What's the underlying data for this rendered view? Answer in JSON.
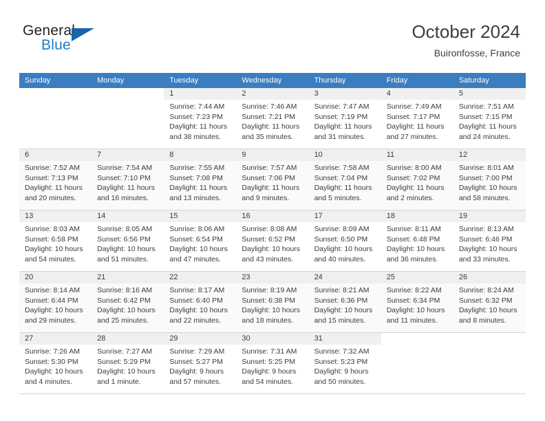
{
  "brand": {
    "name_line1": "General",
    "name_line2": "Blue",
    "logo_icon": "triangle-logo-icon",
    "color_dark": "#231f20",
    "color_blue": "#1c7cc4"
  },
  "header": {
    "title": "October 2024",
    "subtitle": "Buironfosse, France"
  },
  "theme": {
    "header_row_bg": "#3a7dc0",
    "header_row_text": "#ffffff",
    "day_number_bg": "#f0f0f0",
    "grid_line": "#d4d4d4",
    "text": "#3b3b3b"
  },
  "calendar": {
    "weekday_headers": [
      "Sunday",
      "Monday",
      "Tuesday",
      "Wednesday",
      "Thursday",
      "Friday",
      "Saturday"
    ],
    "labels": {
      "sunrise_prefix": "Sunrise:",
      "sunset_prefix": "Sunset:",
      "daylight_prefix": "Daylight:"
    },
    "weeks": [
      [
        {
          "day": "",
          "lines": []
        },
        {
          "day": "",
          "lines": []
        },
        {
          "day": "1",
          "lines": [
            "Sunrise: 7:44 AM",
            "Sunset: 7:23 PM",
            "Daylight: 11 hours",
            "and 38 minutes."
          ]
        },
        {
          "day": "2",
          "lines": [
            "Sunrise: 7:46 AM",
            "Sunset: 7:21 PM",
            "Daylight: 11 hours",
            "and 35 minutes."
          ]
        },
        {
          "day": "3",
          "lines": [
            "Sunrise: 7:47 AM",
            "Sunset: 7:19 PM",
            "Daylight: 11 hours",
            "and 31 minutes."
          ]
        },
        {
          "day": "4",
          "lines": [
            "Sunrise: 7:49 AM",
            "Sunset: 7:17 PM",
            "Daylight: 11 hours",
            "and 27 minutes."
          ]
        },
        {
          "day": "5",
          "lines": [
            "Sunrise: 7:51 AM",
            "Sunset: 7:15 PM",
            "Daylight: 11 hours",
            "and 24 minutes."
          ]
        }
      ],
      [
        {
          "day": "6",
          "lines": [
            "Sunrise: 7:52 AM",
            "Sunset: 7:13 PM",
            "Daylight: 11 hours",
            "and 20 minutes."
          ]
        },
        {
          "day": "7",
          "lines": [
            "Sunrise: 7:54 AM",
            "Sunset: 7:10 PM",
            "Daylight: 11 hours",
            "and 16 minutes."
          ]
        },
        {
          "day": "8",
          "lines": [
            "Sunrise: 7:55 AM",
            "Sunset: 7:08 PM",
            "Daylight: 11 hours",
            "and 13 minutes."
          ]
        },
        {
          "day": "9",
          "lines": [
            "Sunrise: 7:57 AM",
            "Sunset: 7:06 PM",
            "Daylight: 11 hours",
            "and 9 minutes."
          ]
        },
        {
          "day": "10",
          "lines": [
            "Sunrise: 7:58 AM",
            "Sunset: 7:04 PM",
            "Daylight: 11 hours",
            "and 5 minutes."
          ]
        },
        {
          "day": "11",
          "lines": [
            "Sunrise: 8:00 AM",
            "Sunset: 7:02 PM",
            "Daylight: 11 hours",
            "and 2 minutes."
          ]
        },
        {
          "day": "12",
          "lines": [
            "Sunrise: 8:01 AM",
            "Sunset: 7:00 PM",
            "Daylight: 10 hours",
            "and 58 minutes."
          ]
        }
      ],
      [
        {
          "day": "13",
          "lines": [
            "Sunrise: 8:03 AM",
            "Sunset: 6:58 PM",
            "Daylight: 10 hours",
            "and 54 minutes."
          ]
        },
        {
          "day": "14",
          "lines": [
            "Sunrise: 8:05 AM",
            "Sunset: 6:56 PM",
            "Daylight: 10 hours",
            "and 51 minutes."
          ]
        },
        {
          "day": "15",
          "lines": [
            "Sunrise: 8:06 AM",
            "Sunset: 6:54 PM",
            "Daylight: 10 hours",
            "and 47 minutes."
          ]
        },
        {
          "day": "16",
          "lines": [
            "Sunrise: 8:08 AM",
            "Sunset: 6:52 PM",
            "Daylight: 10 hours",
            "and 43 minutes."
          ]
        },
        {
          "day": "17",
          "lines": [
            "Sunrise: 8:09 AM",
            "Sunset: 6:50 PM",
            "Daylight: 10 hours",
            "and 40 minutes."
          ]
        },
        {
          "day": "18",
          "lines": [
            "Sunrise: 8:11 AM",
            "Sunset: 6:48 PM",
            "Daylight: 10 hours",
            "and 36 minutes."
          ]
        },
        {
          "day": "19",
          "lines": [
            "Sunrise: 8:13 AM",
            "Sunset: 6:46 PM",
            "Daylight: 10 hours",
            "and 33 minutes."
          ]
        }
      ],
      [
        {
          "day": "20",
          "lines": [
            "Sunrise: 8:14 AM",
            "Sunset: 6:44 PM",
            "Daylight: 10 hours",
            "and 29 minutes."
          ]
        },
        {
          "day": "21",
          "lines": [
            "Sunrise: 8:16 AM",
            "Sunset: 6:42 PM",
            "Daylight: 10 hours",
            "and 25 minutes."
          ]
        },
        {
          "day": "22",
          "lines": [
            "Sunrise: 8:17 AM",
            "Sunset: 6:40 PM",
            "Daylight: 10 hours",
            "and 22 minutes."
          ]
        },
        {
          "day": "23",
          "lines": [
            "Sunrise: 8:19 AM",
            "Sunset: 6:38 PM",
            "Daylight: 10 hours",
            "and 18 minutes."
          ]
        },
        {
          "day": "24",
          "lines": [
            "Sunrise: 8:21 AM",
            "Sunset: 6:36 PM",
            "Daylight: 10 hours",
            "and 15 minutes."
          ]
        },
        {
          "day": "25",
          "lines": [
            "Sunrise: 8:22 AM",
            "Sunset: 6:34 PM",
            "Daylight: 10 hours",
            "and 11 minutes."
          ]
        },
        {
          "day": "26",
          "lines": [
            "Sunrise: 8:24 AM",
            "Sunset: 6:32 PM",
            "Daylight: 10 hours",
            "and 8 minutes."
          ]
        }
      ],
      [
        {
          "day": "27",
          "lines": [
            "Sunrise: 7:26 AM",
            "Sunset: 5:30 PM",
            "Daylight: 10 hours",
            "and 4 minutes."
          ]
        },
        {
          "day": "28",
          "lines": [
            "Sunrise: 7:27 AM",
            "Sunset: 5:29 PM",
            "Daylight: 10 hours",
            "and 1 minute."
          ]
        },
        {
          "day": "29",
          "lines": [
            "Sunrise: 7:29 AM",
            "Sunset: 5:27 PM",
            "Daylight: 9 hours",
            "and 57 minutes."
          ]
        },
        {
          "day": "30",
          "lines": [
            "Sunrise: 7:31 AM",
            "Sunset: 5:25 PM",
            "Daylight: 9 hours",
            "and 54 minutes."
          ]
        },
        {
          "day": "31",
          "lines": [
            "Sunrise: 7:32 AM",
            "Sunset: 5:23 PM",
            "Daylight: 9 hours",
            "and 50 minutes."
          ]
        },
        {
          "day": "",
          "lines": []
        },
        {
          "day": "",
          "lines": []
        }
      ]
    ]
  }
}
